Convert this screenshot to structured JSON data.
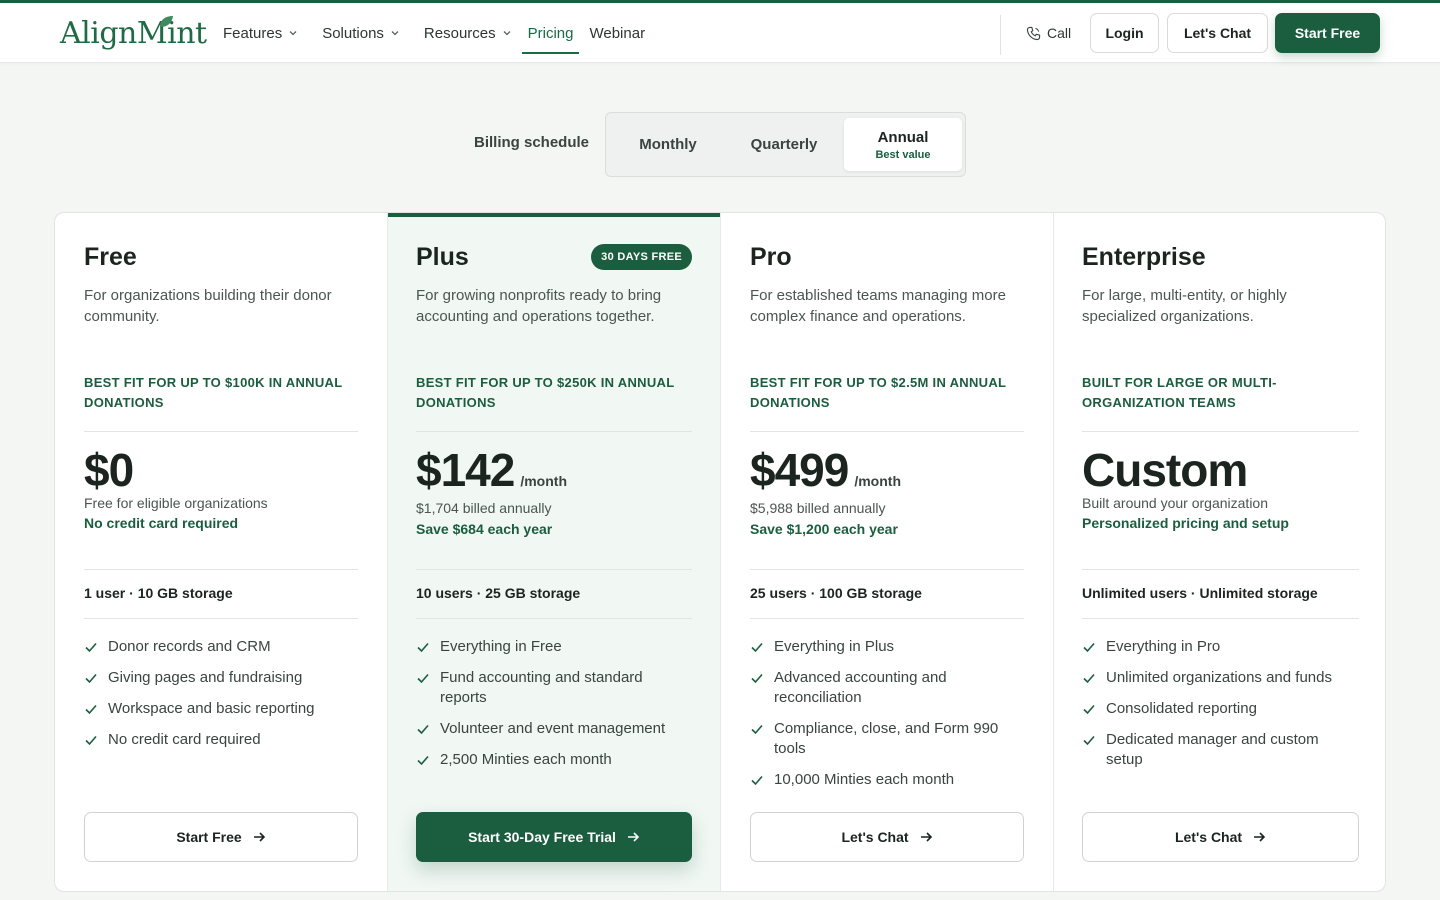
{
  "brand": {
    "name": "AlignMint",
    "color": "#1b5e3f"
  },
  "nav": {
    "items": [
      {
        "label": "Features",
        "dropdown": true
      },
      {
        "label": "Solutions",
        "dropdown": true
      },
      {
        "label": "Resources",
        "dropdown": true
      },
      {
        "label": "Pricing",
        "dropdown": false,
        "active": true
      },
      {
        "label": "Webinar",
        "dropdown": false
      }
    ],
    "call_label": "Call",
    "login_label": "Login",
    "chat_label": "Let's Chat",
    "start_label": "Start Free"
  },
  "billing": {
    "label": "Billing schedule",
    "options": [
      "Monthly",
      "Quarterly",
      "Annual"
    ],
    "selected": "Annual",
    "selected_sub": "Best value"
  },
  "plans": [
    {
      "name": "Free",
      "badge": "",
      "description": "For organizations building their donor community.",
      "fit": "BEST FIT FOR UP TO $100K IN ANNUAL DONATIONS",
      "price": "$0",
      "per": "",
      "note": "Free for eligible organizations",
      "highlight": "No credit card required",
      "limits": "1 user · 10 GB storage",
      "features": [
        "Donor records and CRM",
        "Giving pages and fundraising",
        "Workspace and basic reporting",
        "No credit card required"
      ],
      "cta": "Start Free"
    },
    {
      "name": "Plus",
      "badge": "30 DAYS FREE",
      "description": "For growing nonprofits ready to bring accounting and operations together.",
      "fit": "BEST FIT FOR UP TO $250K IN ANNUAL DONATIONS",
      "price": "$142",
      "per": "/month",
      "note": "$1,704 billed annually",
      "highlight": "Save $684 each year",
      "limits": "10 users · 25 GB storage",
      "features": [
        "Everything in Free",
        "Fund accounting and standard reports",
        "Volunteer and event management",
        "2,500 Minties each month"
      ],
      "cta": "Start 30-Day Free Trial"
    },
    {
      "name": "Pro",
      "badge": "",
      "description": "For established teams managing more complex finance and operations.",
      "fit": "BEST FIT FOR UP TO $2.5M IN ANNUAL DONATIONS",
      "price": "$499",
      "per": "/month",
      "note": "$5,988 billed annually",
      "highlight": "Save $1,200 each year",
      "limits": "25 users · 100 GB storage",
      "features": [
        "Everything in Plus",
        "Advanced accounting and reconciliation",
        "Compliance, close, and Form 990 tools",
        "10,000 Minties each month"
      ],
      "cta": "Let's Chat"
    },
    {
      "name": "Enterprise",
      "badge": "",
      "description": "For large, multi-entity, or highly specialized organizations.",
      "fit": "BUILT FOR LARGE OR MULTI-ORGANIZATION TEAMS",
      "price": "Custom",
      "per": "",
      "note": "Built around your organization",
      "highlight": "Personalized pricing and setup",
      "limits": "Unlimited users · Unlimited storage",
      "features": [
        "Everything in Pro",
        "Unlimited organizations and funds",
        "Consolidated reporting",
        "Dedicated manager and custom setup"
      ],
      "cta": "Let's Chat"
    }
  ]
}
